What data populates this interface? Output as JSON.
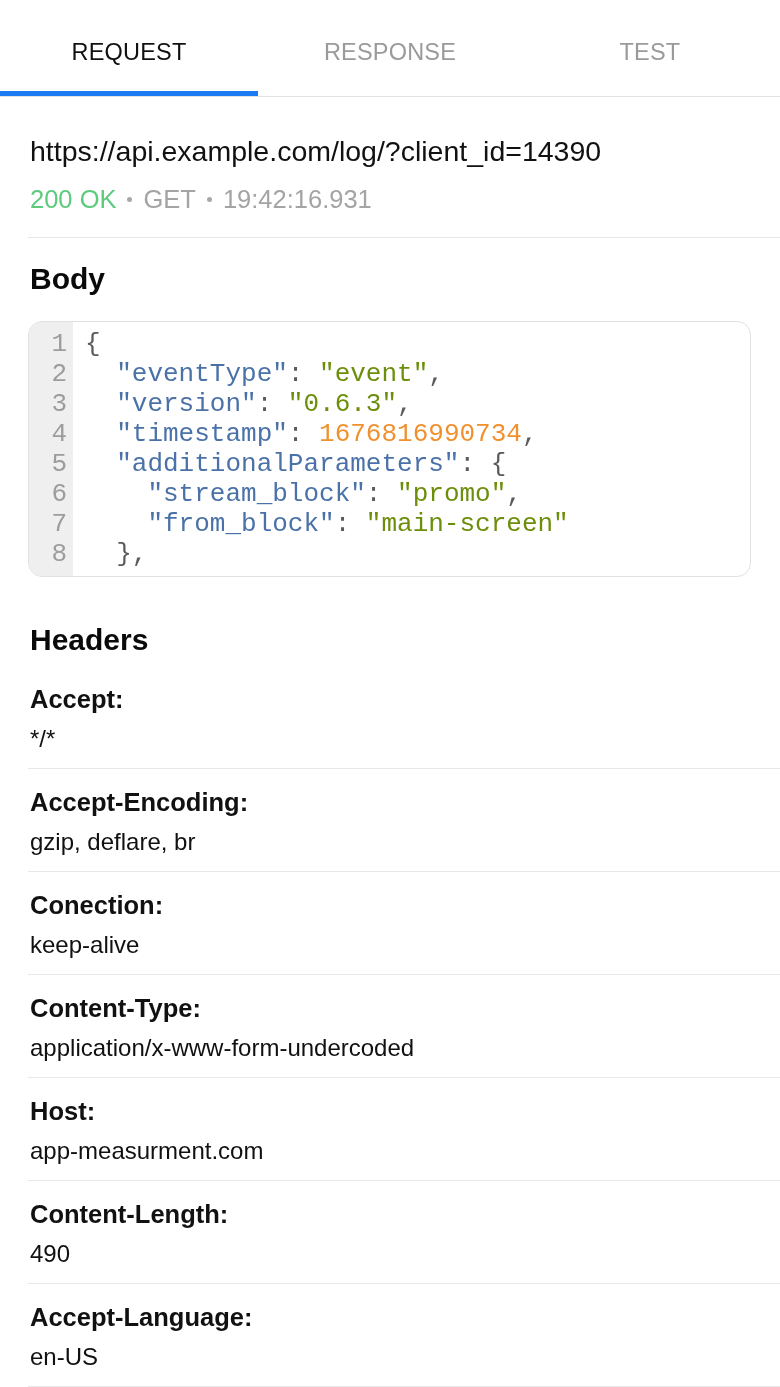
{
  "tabs": [
    {
      "label": "REQUEST",
      "selected": true
    },
    {
      "label": "RESPONSE",
      "selected": false
    },
    {
      "label": "TEST",
      "selected": false
    }
  ],
  "request": {
    "url": "https://api.example.com/log/?client_id=14390",
    "status": "200 OK",
    "status_ok": true,
    "method": "GET",
    "time": "19:42:16.931"
  },
  "body": {
    "title": "Body",
    "code_lines": [
      {
        "number": "1",
        "tokens": [
          {
            "kind": "punct",
            "text": "{"
          }
        ]
      },
      {
        "number": "2",
        "tokens": [
          {
            "kind": "key",
            "text": "  \"eventType\""
          },
          {
            "kind": "punct",
            "text": ": "
          },
          {
            "kind": "string",
            "text": "\"event\""
          },
          {
            "kind": "punct",
            "text": ","
          }
        ]
      },
      {
        "number": "3",
        "tokens": [
          {
            "kind": "key",
            "text": "  \"version\""
          },
          {
            "kind": "punct",
            "text": ": "
          },
          {
            "kind": "string",
            "text": "\"0.6.3\""
          },
          {
            "kind": "punct",
            "text": ","
          }
        ]
      },
      {
        "number": "4",
        "tokens": [
          {
            "kind": "key",
            "text": "  \"timestamp\""
          },
          {
            "kind": "punct",
            "text": ": "
          },
          {
            "kind": "number",
            "text": "1676816990734"
          },
          {
            "kind": "punct",
            "text": ","
          }
        ]
      },
      {
        "number": "5",
        "tokens": [
          {
            "kind": "key",
            "text": "  \"additionalParameters\""
          },
          {
            "kind": "punct",
            "text": ": {"
          }
        ]
      },
      {
        "number": "6",
        "tokens": [
          {
            "kind": "key",
            "text": "    \"stream_block\""
          },
          {
            "kind": "punct",
            "text": ": "
          },
          {
            "kind": "string",
            "text": "\"promo\""
          },
          {
            "kind": "punct",
            "text": ","
          }
        ]
      },
      {
        "number": "7",
        "tokens": [
          {
            "kind": "key",
            "text": "    \"from_block\""
          },
          {
            "kind": "punct",
            "text": ": "
          },
          {
            "kind": "string",
            "text": "\"main-screen\""
          }
        ]
      },
      {
        "number": "8",
        "tokens": [
          {
            "kind": "punct",
            "text": "  },"
          }
        ]
      }
    ]
  },
  "headers": {
    "title": "Headers",
    "items": [
      {
        "name": "Accept:",
        "value": "*/*"
      },
      {
        "name": "Accept-Encoding:",
        "value": "gzip, deflare, br"
      },
      {
        "name": "Conection:",
        "value": "keep-alive"
      },
      {
        "name": "Content-Type:",
        "value": "application/x-www-form-undercoded"
      },
      {
        "name": "Host:",
        "value": "app-measurment.com"
      },
      {
        "name": "Content-Length:",
        "value": "490"
      },
      {
        "name": "Accept-Language:",
        "value": "en-US"
      }
    ]
  }
}
